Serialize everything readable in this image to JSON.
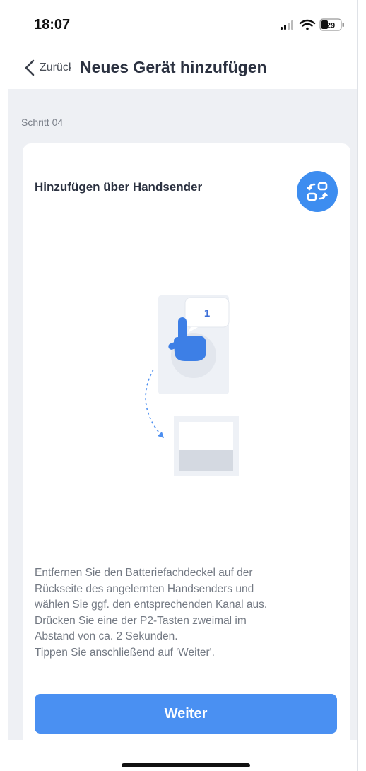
{
  "status_bar": {
    "time": "18:07",
    "battery": "29"
  },
  "header": {
    "back_label": "Zurück",
    "title": "Neues Gerät hinzufügen"
  },
  "step": {
    "label": "Schritt 04"
  },
  "card": {
    "title": "Hinzufügen über Handsender",
    "switch_icon": "swap-layout-icon",
    "illustration": {
      "bubble_number": "1"
    },
    "instructions": [
      "Entfernen Sie den Batteriefachdeckel auf der",
      "Rückseite des angelernten Handsenders und",
      "wählen Sie ggf. den entsprechenden Kanal aus.",
      "Drücken Sie eine der P2-Tasten zweimal im",
      "Abstand von ca. 2 Sekunden.",
      "Tippen Sie anschließend auf 'Weiter'."
    ],
    "next_label": "Weiter"
  },
  "colors": {
    "accent": "#4a90f2",
    "background": "#eef0f4",
    "title_text": "#2b3140",
    "body_text": "#737983"
  }
}
